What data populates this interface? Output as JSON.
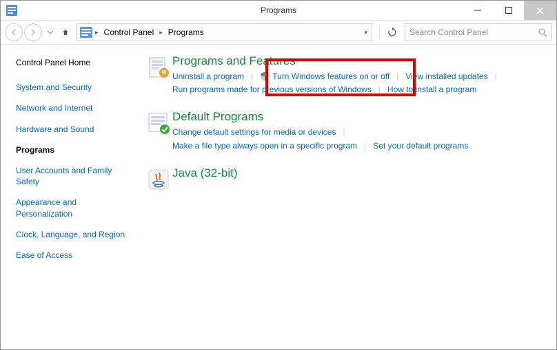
{
  "window": {
    "title": "Programs"
  },
  "breadcrumb": {
    "level1": "Control Panel",
    "level2": "Programs"
  },
  "search": {
    "placeholder": "Search Control Panel"
  },
  "sidebar": {
    "home": "Control Panel Home",
    "items": [
      "System and Security",
      "Network and Internet",
      "Hardware and Sound",
      "Programs",
      "User Accounts and Family Safety",
      "Appearance and Personalization",
      "Clock, Language, and Region",
      "Ease of Access"
    ]
  },
  "categories": {
    "programs_features": {
      "title": "Programs and Features",
      "uninstall": "Uninstall a program",
      "features": "Turn Windows features on or off",
      "updates": "View installed updates",
      "compat": "Run programs made for previous versions of Windows",
      "howto": "How to install a program"
    },
    "default_programs": {
      "title": "Default Programs",
      "change": "Change default settings for media or devices",
      "filetype": "Make a file type always open in a specific program",
      "setdefault": "Set your default programs"
    },
    "java": {
      "title": "Java (32-bit)"
    }
  }
}
